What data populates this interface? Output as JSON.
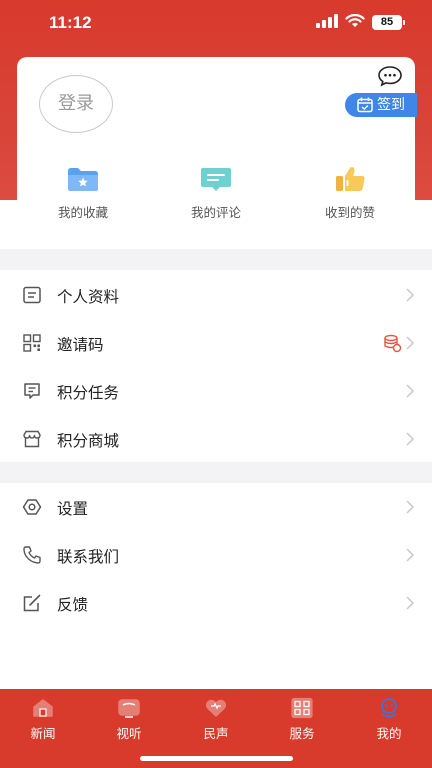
{
  "status_bar": {
    "time": "11:12",
    "battery": "85"
  },
  "profile": {
    "login_label": "登录",
    "signin_label": "签到"
  },
  "quick_actions": [
    {
      "label": "我的收藏",
      "icon": "folder-star-icon"
    },
    {
      "label": "我的评论",
      "icon": "comment-icon"
    },
    {
      "label": "收到的赞",
      "icon": "thumbs-up-icon"
    }
  ],
  "menu_group_1": [
    {
      "label": "个人资料",
      "icon": "profile-doc-icon"
    },
    {
      "label": "邀请码",
      "icon": "qr-code-icon",
      "badge_icon": "coin-stack-icon"
    },
    {
      "label": "积分任务",
      "icon": "task-list-icon"
    },
    {
      "label": "积分商城",
      "icon": "store-icon"
    }
  ],
  "menu_group_2": [
    {
      "label": "设置",
      "icon": "settings-icon"
    },
    {
      "label": "联系我们",
      "icon": "phone-icon"
    },
    {
      "label": "反馈",
      "icon": "edit-icon"
    }
  ],
  "tab_bar": [
    {
      "label": "新闻",
      "icon": "news-icon",
      "active": false
    },
    {
      "label": "视听",
      "icon": "tv-icon",
      "active": false
    },
    {
      "label": "民声",
      "icon": "heart-icon",
      "active": false
    },
    {
      "label": "服务",
      "icon": "service-grid-icon",
      "active": false
    },
    {
      "label": "我的",
      "icon": "mine-icon",
      "active": true
    }
  ],
  "colors": {
    "brand_red": "#d83a2c",
    "signin_blue": "#3e86e8",
    "divider_gray": "#f3f3f5"
  }
}
